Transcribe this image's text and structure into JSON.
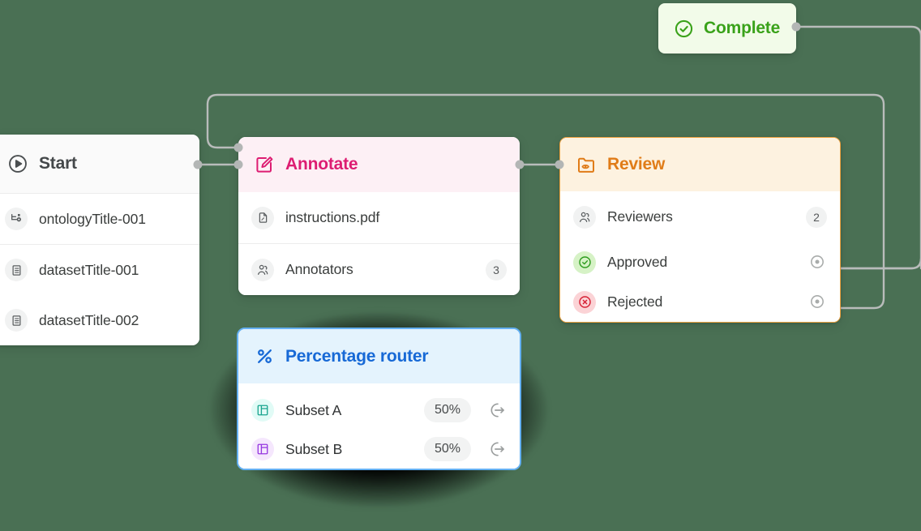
{
  "canvas": {
    "background": "#4a7054",
    "edge_color": "#b9bcbb"
  },
  "nodes": {
    "start": {
      "title": "Start",
      "icon": "play-circle-icon",
      "accent": "#44484a",
      "rows": [
        {
          "label": "ontologyTitle-001",
          "icon": "ontology-icon"
        },
        {
          "label": "datasetTitle-001",
          "icon": "dataset-icon"
        },
        {
          "label": "datasetTitle-002",
          "icon": "dataset-icon"
        }
      ]
    },
    "annotate": {
      "title": "Annotate",
      "icon": "pencil-square-icon",
      "accent": "#dd1d72",
      "rows": [
        {
          "label": "instructions.pdf",
          "icon": "pdf-file-icon",
          "value": ""
        },
        {
          "label": "Annotators",
          "icon": "users-icon",
          "value": "3"
        }
      ]
    },
    "review": {
      "title": "Review",
      "icon": "folder-eye-icon",
      "accent": "#e07c18",
      "rows": [
        {
          "label": "Reviewers",
          "icon": "users-icon",
          "value": "2"
        },
        {
          "label": "Approved",
          "icon": "check-circle-icon",
          "value": ""
        },
        {
          "label": "Rejected",
          "icon": "x-circle-icon",
          "value": ""
        }
      ]
    },
    "complete": {
      "title": "Complete",
      "icon": "check-circle-icon",
      "accent": "#3aa21a"
    },
    "router": {
      "title": "Percentage router",
      "icon": "percent-icon",
      "accent": "#1769d6",
      "selected": true,
      "rows": [
        {
          "label": "Subset A",
          "icon": "panel-icon-teal",
          "value": "50%"
        },
        {
          "label": "Subset B",
          "icon": "panel-icon-purple",
          "value": "50%"
        }
      ]
    }
  }
}
